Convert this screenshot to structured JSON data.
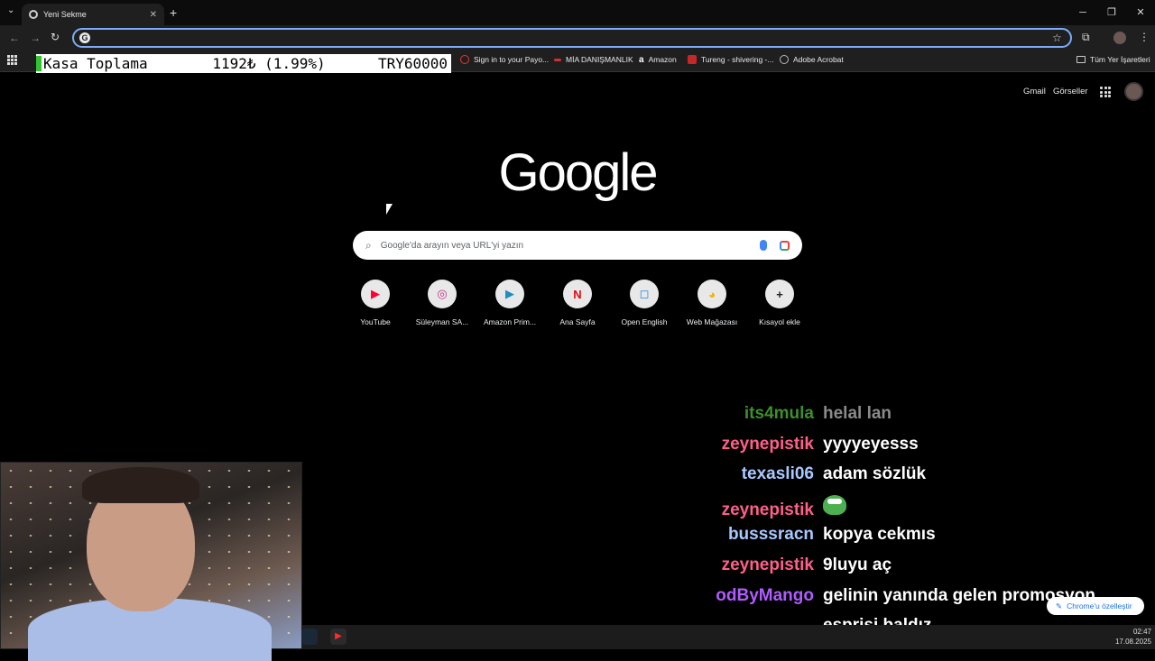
{
  "browser": {
    "tab_title": "Yeni Sekme",
    "tab_close": "✕",
    "new_tab": "+",
    "omnibox_value": ""
  },
  "ticker": {
    "label": "Kasa Toplama",
    "change": "1192₺ (1.99%)",
    "total": "TRY60000"
  },
  "bookmarks": {
    "items": [
      {
        "label": "Sign in to your Payo...",
        "color": "#e53935"
      },
      {
        "label": "MİA DANIŞMANLIK",
        "color": "#d32f2f"
      },
      {
        "label": "Amazon",
        "color": "#ffffff"
      },
      {
        "label": "Tureng - shivering -...",
        "color": "#c62828"
      },
      {
        "label": "Adobe Acrobat",
        "color": "#9e9e9e"
      }
    ],
    "all_bookmarks": "Tüm Yer İşaretleri"
  },
  "header": {
    "gmail": "Gmail",
    "images": "Görseller"
  },
  "logo": "Google",
  "search": {
    "placeholder": "Google'da arayın veya URL'yi yazın"
  },
  "shortcuts": [
    {
      "label": "YouTube",
      "glyph": "▶",
      "color": "#ff0033"
    },
    {
      "label": "Süleyman SA...",
      "glyph": "◎",
      "color": "#c13584"
    },
    {
      "label": "Amazon Prim...",
      "glyph": "▶",
      "color": "#1f8fc0"
    },
    {
      "label": "Ana Sayfa",
      "glyph": "N",
      "color": "#e50914"
    },
    {
      "label": "Open English",
      "glyph": "◻",
      "color": "#1e88e5"
    },
    {
      "label": "Web Mağazası",
      "glyph": "◕",
      "color": "#f4b400"
    },
    {
      "label": "Kısayol ekle",
      "glyph": "+",
      "color": "#202124"
    }
  ],
  "chat": [
    {
      "user": "its4mula",
      "text": "helal lan",
      "color": "#3e8e2c",
      "dim": true
    },
    {
      "user": "zeynepistik",
      "text": "yyyyeyesss",
      "color": "#ff5f8a",
      "dim": false
    },
    {
      "user": "texasli06",
      "text": "adam sözlük",
      "color": "#a8c8ff",
      "dim": false
    },
    {
      "user": "zeynepistik",
      "text": "",
      "color": "#ff5f8a",
      "dim": false,
      "emote": true
    },
    {
      "user": "busssracn",
      "text": "kopya cekmıs",
      "color": "#a8c8ff",
      "dim": false
    },
    {
      "user": "zeynepistik",
      "text": "9luyu aç",
      "color": "#ff5f8a",
      "dim": false
    },
    {
      "user": "odByMango",
      "text": "gelinin yanında gelen promosyon",
      "color": "#b05cff",
      "dim": false
    },
    {
      "user": "",
      "text": "esprisi baldız",
      "color": "#ffffff",
      "dim": false
    }
  ],
  "customize_label": "Chrome'u özelleştir",
  "clock": {
    "time": "02:47",
    "date": "17.08.2025"
  }
}
